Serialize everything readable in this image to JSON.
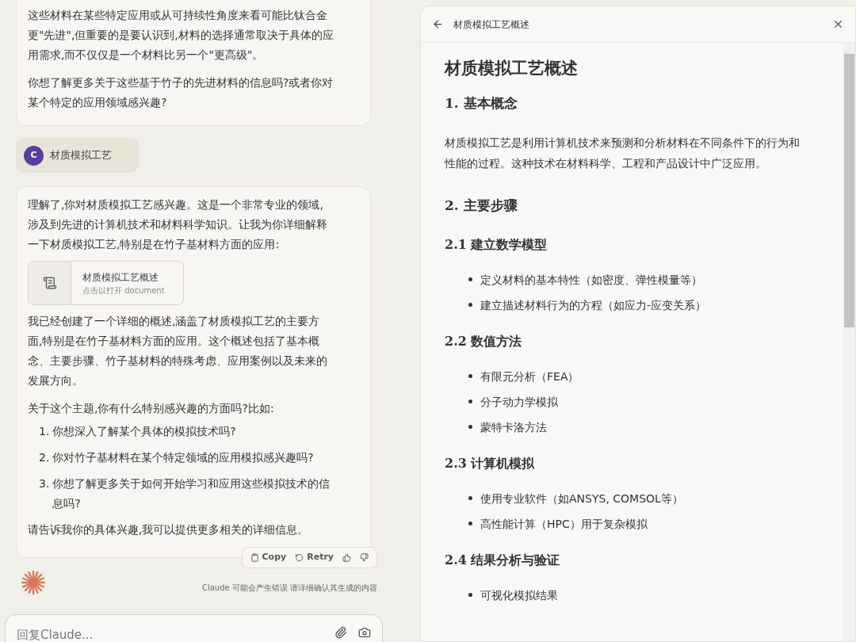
{
  "chat": {
    "previous_reply": {
      "paragraphs": [
        "这些材料在某些特定应用或从可持续性角度来看可能比钛合金更\"先进\",但重要的是要认识到,材料的选择通常取决于具体的应用需求,而不仅仅是一个材料比另一个\"更高级\"。",
        "你想了解更多关于这些基于竹子的先进材料的信息吗?或者你对某个特定的应用领域感兴趣?"
      ]
    },
    "user_message": {
      "avatar": "C",
      "text": "材质模拟工艺"
    },
    "reply": {
      "intro": "理解了,你对材质模拟工艺感兴趣。这是一个非常专业的领域,涉及到先进的计算机技术和材料科学知识。让我为你详细解释一下材质模拟工艺,特别是在竹子基材料方面的应用:",
      "artifact": {
        "title": "材质模拟工艺概述",
        "subtitle": "点击以打开 document"
      },
      "summary": "我已经创建了一个详细的概述,涵盖了材质模拟工艺的主要方面,特别是在竹子基材料方面的应用。这个概述包括了基本概念、主要步骤、竹子基材料的特殊考虑、应用案例以及未来的发展方向。",
      "question": "关于这个主题,你有什么特别感兴趣的方面吗?比如:",
      "options": [
        {
          "number": "1.",
          "text": "你想深入了解某个具体的模拟技术吗?"
        },
        {
          "number": "2.",
          "text": "你对竹子基材料在某个特定领域的应用模拟感兴趣吗?"
        },
        {
          "number": "3.",
          "text": "你想了解更多关于如何开始学习和应用这些模拟技术的信息吗?"
        }
      ],
      "closing": "请告诉我你的具体兴趣,我可以提供更多相关的详细信息。"
    },
    "actions": [
      {
        "kind": "copy",
        "label": "Copy"
      },
      {
        "kind": "retry",
        "label": "Retry"
      },
      {
        "kind": "thumbs_up"
      },
      {
        "kind": "thumbs_down"
      }
    ],
    "disclaimer": "Claude 可能会产生错误 请详细确认其生成的内容",
    "input": {
      "placeholder": "回复Claude..."
    }
  },
  "document": {
    "header_title": "材质模拟工艺概述",
    "blocks": [
      {
        "kind": "h1",
        "text": "材质模拟工艺概述"
      },
      {
        "kind": "h2",
        "text": "1. 基本概念"
      },
      {
        "kind": "p",
        "text": "材质模拟工艺是利用计算机技术来预测和分析材料在不同条件下的行为和性能的过程。这种技术在材料科学、工程和产品设计中广泛应用。"
      },
      {
        "kind": "h2",
        "text": "2. 主要步骤"
      },
      {
        "kind": "h3",
        "text": "2.1 建立数学模型"
      },
      {
        "kind": "ul",
        "items": [
          "定义材料的基本特性（如密度、弹性模量等）",
          "建立描述材料行为的方程（如应力-应变关系）"
        ]
      },
      {
        "kind": "h3",
        "text": "2.2 数值方法"
      },
      {
        "kind": "ul",
        "items": [
          "有限元分析（FEA）",
          "分子动力学模拟",
          "蒙特卡洛方法"
        ]
      },
      {
        "kind": "h3",
        "text": "2.3 计算机模拟"
      },
      {
        "kind": "ul",
        "items": [
          "使用专业软件（如ANSYS, COMSOL等）",
          "高性能计算（HPC）用于复杂模拟"
        ]
      },
      {
        "kind": "h3",
        "text": "2.4 结果分析与验证"
      },
      {
        "kind": "ul",
        "items": [
          "可视化模拟结果"
        ]
      }
    ]
  }
}
